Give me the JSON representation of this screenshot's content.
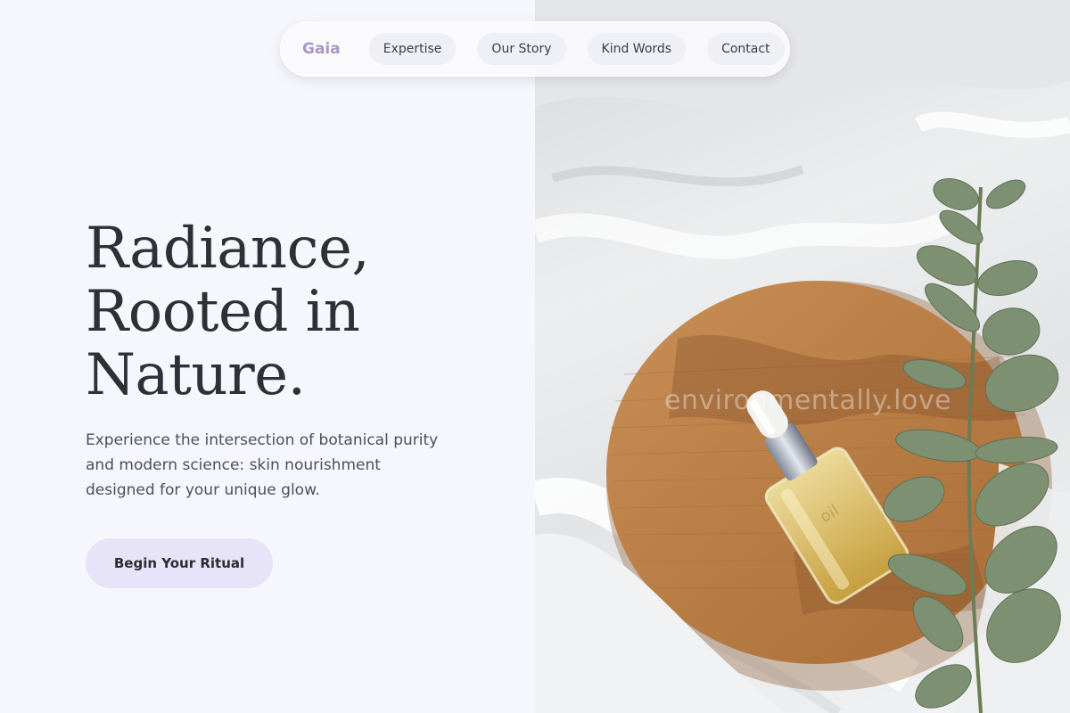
{
  "nav": {
    "brand": "Gaia",
    "links": [
      "Expertise",
      "Our Story",
      "Kind Words",
      "Contact"
    ]
  },
  "hero": {
    "headline_lines": [
      "Radiance,",
      "Rooted in",
      "Nature."
    ],
    "subtext": "Experience the intersection of botanical purity and modern science: skin nourishment designed for your unique glow.",
    "cta_label": "Begin Your Ritual"
  },
  "image": {
    "watermark": "environmentally.love",
    "bottle_label": "oil"
  },
  "colors": {
    "brand": "#a898c4",
    "cta_background": "#e7e3f8",
    "page_background": "#f6f7fc",
    "headline": "#2e3035"
  }
}
